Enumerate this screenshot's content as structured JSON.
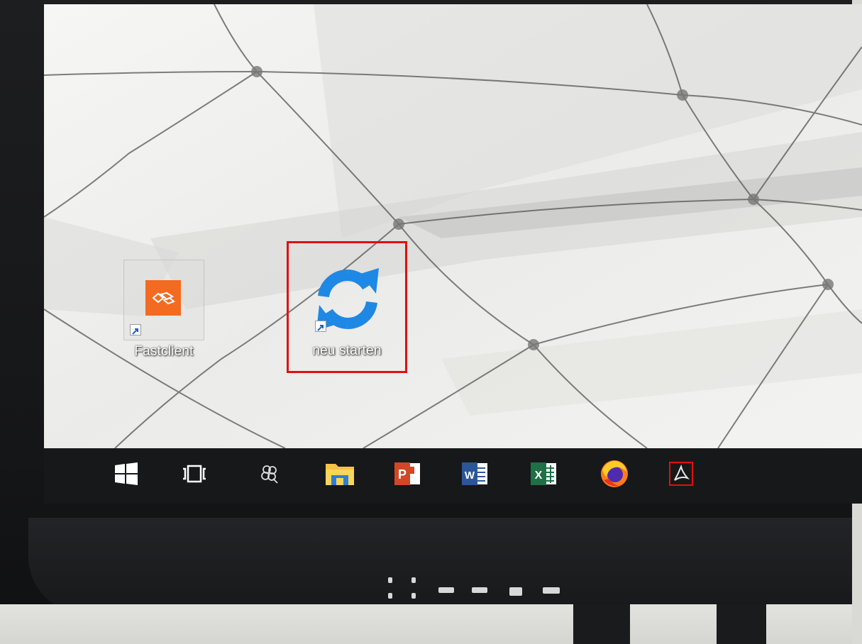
{
  "desktop": {
    "icons": [
      {
        "label": "Fastclient",
        "icon": "fastclient-icon",
        "color": "#f26b21"
      },
      {
        "label": "neu starten",
        "icon": "refresh-icon",
        "color": "#1e88e5",
        "highlighted": true
      }
    ]
  },
  "taskbar": {
    "items": [
      {
        "name": "start-button",
        "icon": "windows-icon"
      },
      {
        "name": "task-view-button",
        "icon": "task-view-icon"
      },
      {
        "name": "cluster-app-button",
        "icon": "cluster-icon"
      },
      {
        "name": "file-explorer-button",
        "icon": "folder-icon"
      },
      {
        "name": "powerpoint-button",
        "icon": "powerpoint-icon",
        "letter": "P",
        "color": "#d24726"
      },
      {
        "name": "word-button",
        "icon": "word-icon",
        "letter": "W",
        "color": "#2b5797"
      },
      {
        "name": "excel-button",
        "icon": "excel-icon",
        "letter": "X",
        "color": "#1e7145"
      },
      {
        "name": "firefox-button",
        "icon": "firefox-icon"
      },
      {
        "name": "acrobat-button",
        "icon": "acrobat-icon",
        "color": "#e01010"
      }
    ]
  },
  "colors": {
    "highlight": "#e01010",
    "taskbar": "#17181a"
  }
}
